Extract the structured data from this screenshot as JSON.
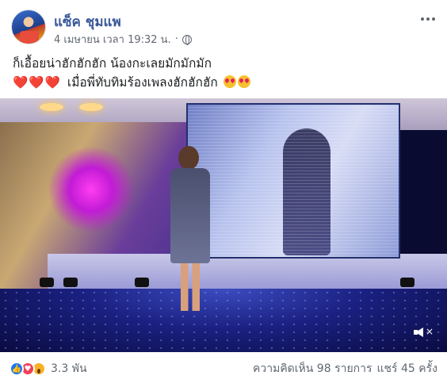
{
  "post": {
    "author": "แซ็ค ชุมแพ",
    "timestamp": "4 เมษายน เวลา 19:32 น.",
    "separator": "·",
    "privacy_icon": "globe-icon",
    "more_icon": "more-horizontal-icon",
    "text_line1": "ก็เอื้อยน่าฮักฮักฮัก น้องกะเลยมักมักมัก",
    "hearts": "❤️❤️❤️",
    "text_line2": "เมื่อพี่ทับทิมร้องเพลงฮักฮักฮัก"
  },
  "video": {
    "mute_icon": "volume-mute-icon",
    "mute_mark": "×"
  },
  "footer": {
    "reaction_icons": [
      "like-icon",
      "love-icon",
      "wow-icon"
    ],
    "reaction_count": "3.3 พัน",
    "comments": "ความคิดเห็น 98 รายการ",
    "shares": "แชร์ 45 ครั้ง"
  },
  "colors": {
    "author": "#385898",
    "like": "#1877f2",
    "love": "#f33e58",
    "wow": "#f7b125"
  }
}
